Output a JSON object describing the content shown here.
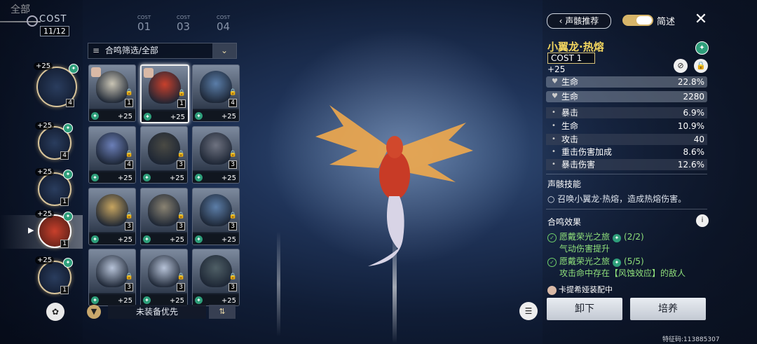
{
  "left_rail": {
    "cost_label": "COST",
    "cost_count": "11/12",
    "slots": [
      {
        "level": "+25",
        "cost": "4"
      },
      {
        "level": "+25",
        "cost": "4"
      },
      {
        "level": "+25",
        "cost": "1"
      },
      {
        "level": "+25",
        "cost": "1"
      },
      {
        "level": "+25",
        "cost": "1"
      }
    ]
  },
  "tabs": [
    {
      "label": "全部"
    },
    {
      "small": "COST",
      "num": "01"
    },
    {
      "small": "COST",
      "num": "03"
    },
    {
      "small": "COST",
      "num": "04"
    }
  ],
  "filter": {
    "label": "合鸣筛选/全部"
  },
  "grid": [
    {
      "cost": "1",
      "level": "+25",
      "color": "#c9c4b4"
    },
    {
      "cost": "1",
      "level": "+25",
      "color": "#c8402c"
    },
    {
      "cost": "4",
      "level": "+25",
      "color": "#5a7da8"
    },
    {
      "cost": "4",
      "level": "+25",
      "color": "#6b7fb8"
    },
    {
      "cost": "3",
      "level": "+25",
      "color": "#4a4a44"
    },
    {
      "cost": "3",
      "level": "+25",
      "color": "#6e7280"
    },
    {
      "cost": "3",
      "level": "+25",
      "color": "#c7a560"
    },
    {
      "cost": "3",
      "level": "+25",
      "color": "#8a8372"
    },
    {
      "cost": "3",
      "level": "+25",
      "color": "#5c7ea8"
    },
    {
      "cost": "3",
      "level": "+25",
      "color": "#b7c3d8"
    },
    {
      "cost": "3",
      "level": "+25",
      "color": "#b7c3d8"
    },
    {
      "cost": "3",
      "level": "+25",
      "color": "#4f5f66"
    }
  ],
  "sort": {
    "label": "未装备优先"
  },
  "panel": {
    "recommend_label": "声骸推荐",
    "brief_label": "简述",
    "echo_name": "小翼龙·热熔",
    "echo_cost": "COST 1",
    "echo_level": "+25",
    "main_stats": [
      {
        "name": "生命",
        "value": "22.8%"
      },
      {
        "name": "生命",
        "value": "2280"
      }
    ],
    "sub_stats": [
      {
        "name": "暴击",
        "value": "6.9%"
      },
      {
        "name": "生命",
        "value": "10.9%"
      },
      {
        "name": "攻击",
        "value": "40"
      },
      {
        "name": "重击伤害加成",
        "value": "8.6%"
      },
      {
        "name": "暴击伤害",
        "value": "12.6%"
      }
    ],
    "skill_title": "声骸技能",
    "skill_desc": "召唤小翼龙·热熔，造成热熔伤害。",
    "set_title": "合鸣效果",
    "set_lines": [
      {
        "name": "愿戴荣光之旅",
        "count": "(2/2)",
        "desc": "气动伤害提升"
      },
      {
        "name": "愿戴荣光之旅",
        "count": "(5/5)",
        "desc": "攻击命中存在【风蚀效应】的敌人"
      }
    ],
    "equipped_by": "卡提希娅装配中",
    "unequip_label": "卸下",
    "upgrade_label": "培养",
    "uid": "特征码:113885307"
  }
}
